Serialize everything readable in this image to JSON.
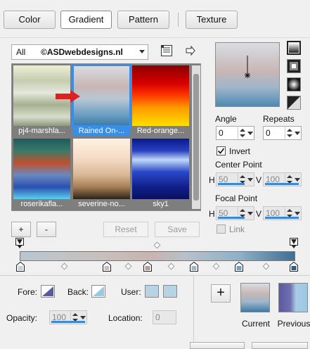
{
  "tabs": [
    {
      "label": "Color",
      "active": false
    },
    {
      "label": "Gradient",
      "active": true
    },
    {
      "label": "Pattern",
      "active": false
    },
    {
      "label": "Texture",
      "active": false
    }
  ],
  "library": {
    "filter": "All",
    "name": "©ASDwebdesigns.nl"
  },
  "thumbnails": [
    {
      "label": "pj4-marshla...",
      "selected": false
    },
    {
      "label": "Rained On-...",
      "selected": true
    },
    {
      "label": "Red-orange...",
      "selected": false
    },
    {
      "label": "roserikafla...",
      "selected": false
    },
    {
      "label": "severine-no...",
      "selected": false
    },
    {
      "label": "sky1",
      "selected": false
    }
  ],
  "list_buttons": {
    "add": "+",
    "remove": "-",
    "reset": "Reset",
    "save": "Save"
  },
  "properties": {
    "angle_label": "Angle",
    "angle_value": "0",
    "repeats_label": "Repeats",
    "repeats_value": "0",
    "invert_label": "Invert",
    "invert_checked": true,
    "center_point_label": "Center Point",
    "center_h_label": "H",
    "center_h_value": "50",
    "center_v_label": "V",
    "center_v_value": "100",
    "focal_point_label": "Focal Point",
    "focal_h_label": "H",
    "focal_h_value": "50",
    "focal_v_label": "V",
    "focal_v_value": "100",
    "link_label": "Link",
    "link_checked": false
  },
  "stops": {
    "fore_label": "Fore:",
    "back_label": "Back:",
    "user_label": "User:",
    "opacity_label": "Opacity:",
    "opacity_value": "100",
    "location_label": "Location:",
    "location_value": "0"
  },
  "current_previous": {
    "current_label": "Current",
    "previous_label": "Previous",
    "add_symbol": "+"
  },
  "colors": {
    "accent": "#3a8ee6",
    "red_arrow": "#e02020",
    "fore_swatch": "#5b5aa0",
    "back_swatch": "#9cc8e4",
    "user_swatch": "#b8d4e4"
  }
}
